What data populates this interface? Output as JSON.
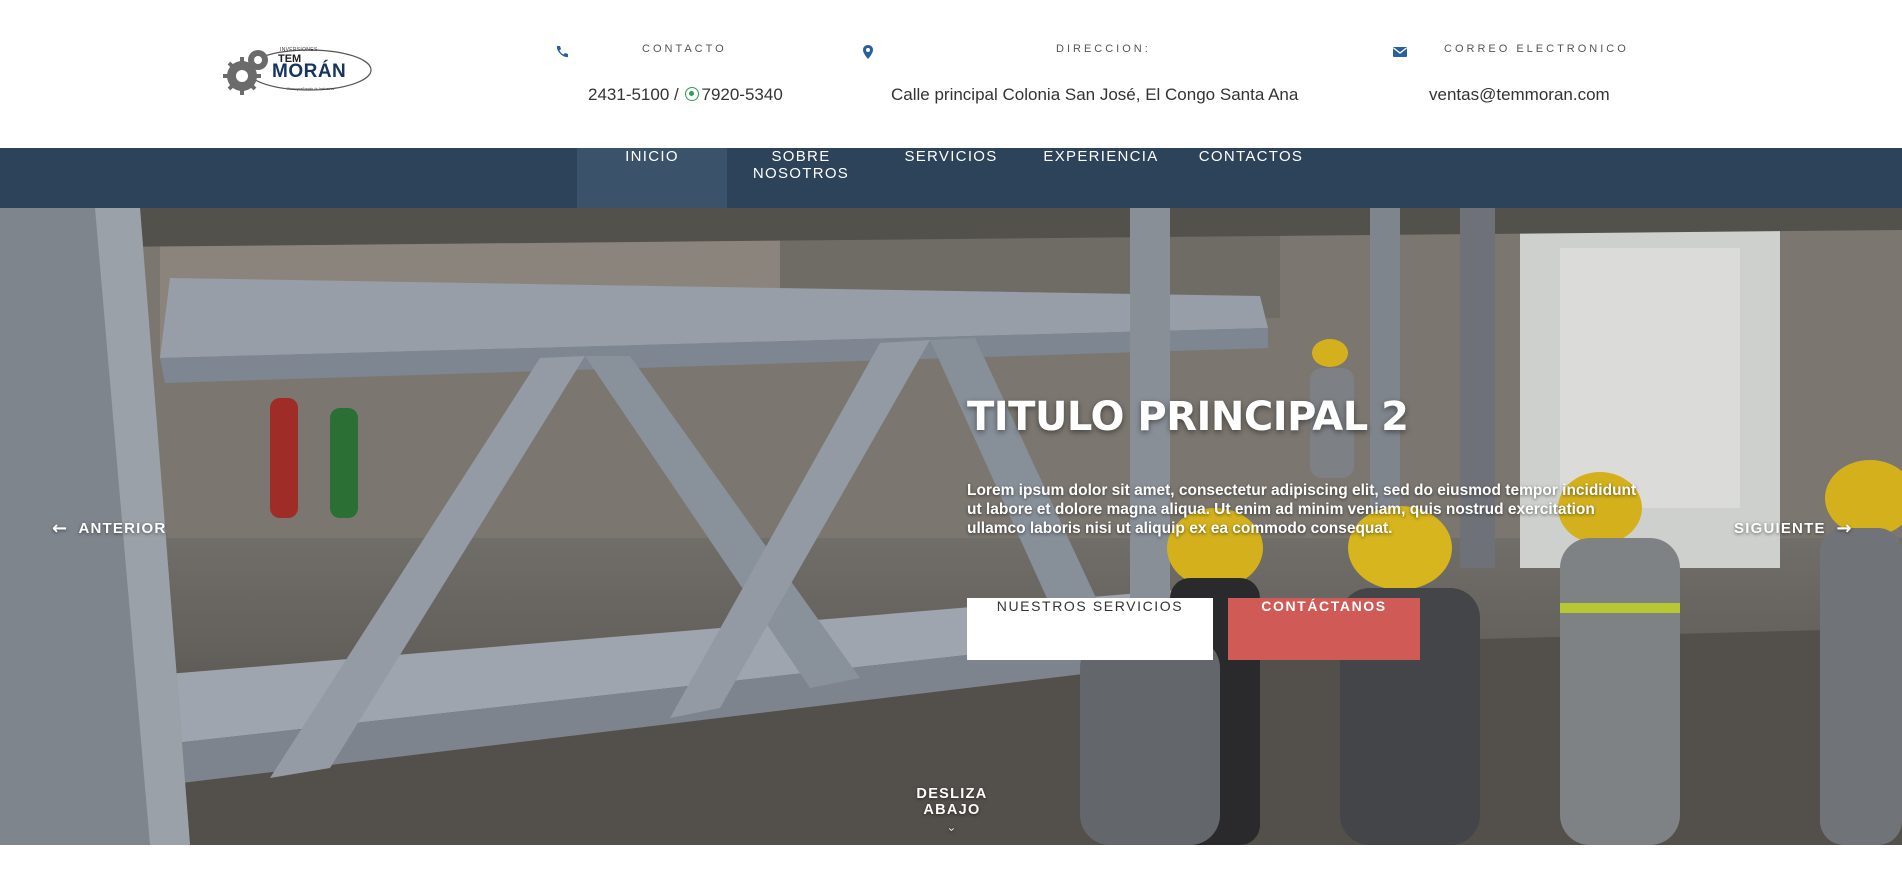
{
  "logo": {
    "small_top": "INVERSIONES",
    "line1": "TEM",
    "line2": "MORÁN",
    "slogan": "\"Acompañando la Industria\""
  },
  "contact": {
    "phone_label": "CONTACTO",
    "phone_main": "2431-5100 /",
    "whatsapp": "7920-5340",
    "address_label": "DIRECCION:",
    "address": "Calle principal Colonia San José, El Congo Santa Ana",
    "email_label": "CORREO ELECTRONICO",
    "email": "ventas@temmoran.com"
  },
  "nav": {
    "items": [
      "INICIO",
      "SOBRE NOSOTROS",
      "SERVICIOS",
      "EXPERIENCIA",
      "CONTACTOS"
    ],
    "active": "INICIO"
  },
  "hero": {
    "title": "TITULO PRINCIPAL 2",
    "text": "Lorem ipsum dolor sit amet, consectetur adipiscing elit, sed do eiusmod tempor incididunt ut labore et dolore magna aliqua. Ut enim ad minim veniam, quis nostrud exercitation ullamco laboris nisi ut aliquip ex ea commodo consequat.",
    "btn_services": "NUESTROS SERVICIOS",
    "btn_contact": "CONTÁCTANOS",
    "prev": "ANTERIOR",
    "next": "SIGUIENTE",
    "scroll": "DESLIZA ABAJO"
  },
  "icons": {
    "phone": "phone-icon",
    "location": "map-marker-icon",
    "email": "envelope-icon",
    "whatsapp": "whatsapp-icon",
    "prev": "arrow-left-icon",
    "next": "arrow-right-icon",
    "scroll": "chevron-down-icon"
  },
  "colors": {
    "nav_bg": "#2c4359",
    "nav_active": "#3a536b",
    "accent_red": "#cf5a56",
    "icon_blue": "#2a5f9e",
    "brand_blue": "#15345f"
  }
}
